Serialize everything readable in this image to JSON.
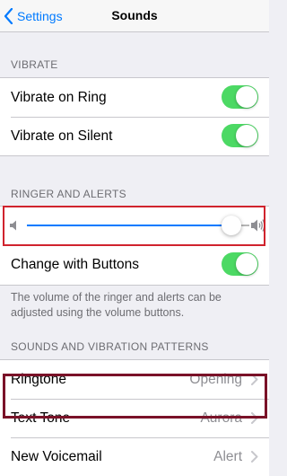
{
  "navbar": {
    "back_label": "Settings",
    "title": "Sounds"
  },
  "vibrate": {
    "header": "VIBRATE",
    "rows": [
      {
        "label": "Vibrate on Ring",
        "on": true
      },
      {
        "label": "Vibrate on Silent",
        "on": true
      }
    ]
  },
  "ringer": {
    "header": "RINGER AND ALERTS",
    "volume_level": 0.92,
    "change_with_buttons_label": "Change with Buttons",
    "change_with_buttons_on": true,
    "note": "The volume of the ringer and alerts can be adjusted using the volume buttons."
  },
  "patterns": {
    "header": "SOUNDS AND VIBRATION PATTERNS",
    "rows": [
      {
        "label": "Ringtone",
        "value": "Opening"
      },
      {
        "label": "Text Tone",
        "value": "Aurora"
      },
      {
        "label": "New Voicemail",
        "value": "Alert"
      }
    ]
  },
  "colors": {
    "accent": "#007aff",
    "toggle_on": "#4cd964",
    "slider_highlight": "#d0232d",
    "text_tone_highlight": "#7a1228"
  },
  "icons": {
    "back": "chevron-left-icon",
    "volume_low": "speaker-low-icon",
    "volume_high": "speaker-high-icon",
    "disclosure": "chevron-right-icon"
  }
}
